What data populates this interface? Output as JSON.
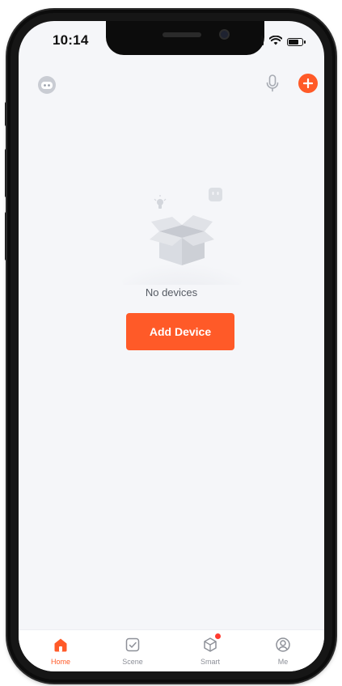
{
  "status_bar": {
    "time": "10:14"
  },
  "header": {
    "avatar_icon": "home-avatar-icon",
    "mic_icon": "microphone-icon",
    "add_icon": "plus-icon"
  },
  "empty_state": {
    "message": "No devices",
    "button_label": "Add Device",
    "illustration_icon": "empty-box-icon"
  },
  "tabs": [
    {
      "label": "Home",
      "icon": "home-icon",
      "active": true
    },
    {
      "label": "Scene",
      "icon": "scene-check-icon",
      "active": false
    },
    {
      "label": "Smart",
      "icon": "smart-cube-icon",
      "active": false,
      "badge": true
    },
    {
      "label": "Me",
      "icon": "profile-icon",
      "active": false
    }
  ],
  "colors": {
    "accent": "#ff5a28",
    "screen_background": "#f5f6f9",
    "tab_inactive": "#8d9098"
  }
}
